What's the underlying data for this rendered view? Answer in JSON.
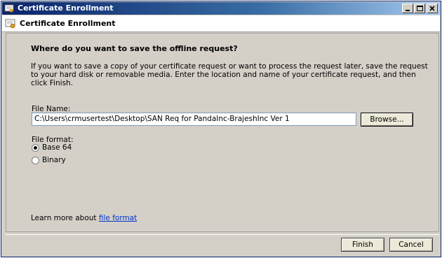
{
  "window": {
    "title": "Certificate Enrollment",
    "buttons": {
      "minimize_icon": "minimize-icon",
      "maximize_icon": "maximize-icon",
      "close_icon": "close-icon"
    }
  },
  "header": {
    "title": "Certificate Enrollment",
    "icon": "certificate-icon"
  },
  "content": {
    "question": "Where do you want to save the offline request?",
    "description": "If you want to save a copy of your certificate request or want to process the request later, save the request to your hard disk or removable media. Enter the location and name of your certificate request, and then click Finish.",
    "file_name_label": "File Name:",
    "file_name_value": "C:\\Users\\crmusertest\\Desktop\\SAN Req for PandaInc-BrajeshInc Ver 1",
    "browse_label": "Browse...",
    "file_format_label": "File format:",
    "formats": [
      {
        "label": "Base 64",
        "selected": true
      },
      {
        "label": "Binary",
        "selected": false
      }
    ],
    "learn_more_prefix": "Learn more about ",
    "learn_more_link": "file format"
  },
  "footer": {
    "finish_label": "Finish",
    "cancel_label": "Cancel"
  }
}
